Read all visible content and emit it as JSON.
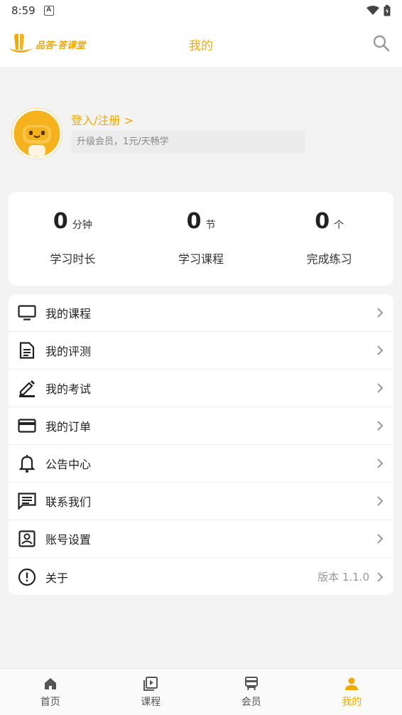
{
  "status": {
    "time": "8:59"
  },
  "header": {
    "logo_text": "品答·答课堂",
    "title": "我的"
  },
  "profile": {
    "login_label": "登入/注册 >",
    "vip_tip": "升级会员，1元/天畅学"
  },
  "stats": [
    {
      "value": "0",
      "unit": "分钟",
      "label": "学习时长"
    },
    {
      "value": "0",
      "unit": "节",
      "label": "学习课程"
    },
    {
      "value": "0",
      "unit": "个",
      "label": "完成练习"
    }
  ],
  "menu": [
    {
      "label": "我的课程",
      "icon": "monitor-icon"
    },
    {
      "label": "我的评测",
      "icon": "document-icon"
    },
    {
      "label": "我的考试",
      "icon": "pen-icon"
    },
    {
      "label": "我的订单",
      "icon": "credit-card-icon"
    },
    {
      "label": "公告中心",
      "icon": "bell-icon"
    },
    {
      "label": "联系我们",
      "icon": "message-icon"
    },
    {
      "label": "账号设置",
      "icon": "account-box-icon"
    },
    {
      "label": "关于",
      "icon": "info-icon",
      "extra": "版本 1.1.0"
    }
  ],
  "tabs": [
    {
      "label": "首页",
      "icon": "home-icon"
    },
    {
      "label": "课程",
      "icon": "play-library-icon"
    },
    {
      "label": "会员",
      "icon": "vip-icon"
    },
    {
      "label": "我的",
      "icon": "person-icon",
      "active": true
    }
  ],
  "colors": {
    "accent": "#f2a900",
    "background": "#f3f3f3"
  }
}
